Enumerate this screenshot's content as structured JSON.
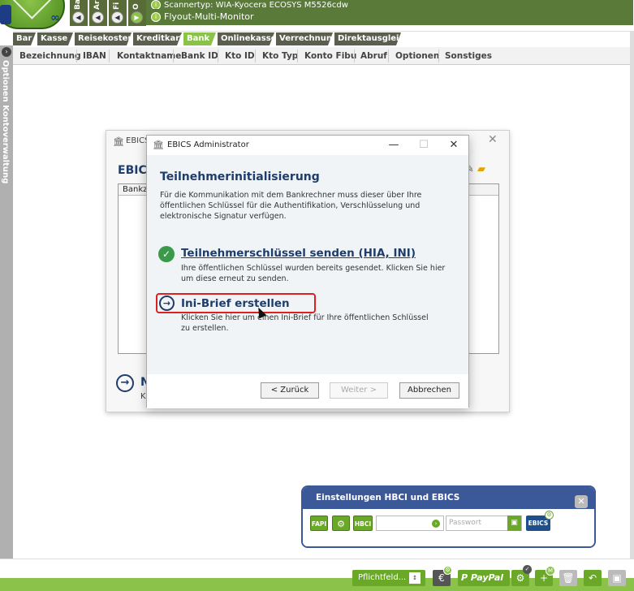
{
  "topbar": {
    "vertical_labels": [
      "Ba",
      "Ar",
      "Fi",
      "O"
    ],
    "scanner_text": "Scannertyp: WIA-Kyocera ECOSYS M5526cdw",
    "monitor_text": "Flyout-Multi-Monitor"
  },
  "leftbar": {
    "label": "Optionen  Kontoverwaltung"
  },
  "tabs": [
    {
      "label": "Bar"
    },
    {
      "label": "Kasse"
    },
    {
      "label": "Reisekosten"
    },
    {
      "label": "Kreditkarte"
    },
    {
      "label": "Bank",
      "active": true
    },
    {
      "label": "Onlinekasse"
    },
    {
      "label": "Verrechnung"
    },
    {
      "label": "Direktausgleich"
    }
  ],
  "columns": [
    "Bezeichnung",
    "IBAN",
    "Kontaktname",
    "Bank ID",
    "Kto ID",
    "Kto Typ",
    "Konto Fibu",
    "Abruf",
    "Optionen",
    "Sonstiges"
  ],
  "bg_dialog": {
    "title": "EBICS",
    "heading": "EBICS",
    "list_header": "Bankzu",
    "next_label": "N",
    "next_sub": "K"
  },
  "dialog": {
    "title": "EBICS Administrator",
    "heading": "Teilnehmerinitialisierung",
    "intro": "Für die Kommunikation mit dem Bankrechner muss dieser über Ihre öffentlichen Schlüssel für die Authentifikation, Verschlüsselung und elektronische Signatur verfügen.",
    "option1_title": "Teilnehmerschlüssel senden (HIA, INI)",
    "option1_desc": "Ihre öffentlichen Schlüssel wurden bereits gesendet. Klicken Sie hier um diese erneut zu senden.",
    "option2_title": "Ini-Brief erstellen",
    "option2_desc": "Klicken Sie hier um einen Ini-Brief für Ihre öffentlichen Schlüssel zu erstellen.",
    "back_label": "< Zurück",
    "next_label": "Weiter >",
    "cancel_label": "Abbrechen"
  },
  "hbci_panel": {
    "title": "Einstellungen HBCI und EBICS",
    "fapi_label": "FAPI",
    "hbci_label": "HBCI",
    "password_placeholder": "Passwort",
    "ebics_label": "EBICS"
  },
  "bottombar": {
    "pflicht_label": "Pflichtfeld...",
    "paypal_label": "PayPal"
  },
  "colors": {
    "brand_green": "#8bc34a",
    "dark_green": "#6aa827",
    "navy": "#1f3d6a",
    "panel_blue": "#3b5998",
    "highlight_red": "#e02020"
  }
}
